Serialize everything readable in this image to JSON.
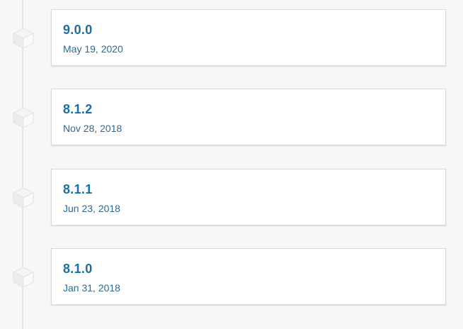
{
  "releases": [
    {
      "version": "9.0.0",
      "date": "May 19, 2020"
    },
    {
      "version": "8.1.2",
      "date": "Nov 28, 2018"
    },
    {
      "version": "8.1.1",
      "date": "Jun 23, 2018"
    },
    {
      "version": "8.1.0",
      "date": "Jan 31, 2018"
    }
  ],
  "icons": {
    "release_marker": "package-cube-icon"
  },
  "colors": {
    "version_link": "#1a6f9e",
    "date_text": "#2b6a92",
    "timeline_line": "#e6e6e6",
    "card_border": "#d9d9d9",
    "background": "#f7f7f7"
  }
}
